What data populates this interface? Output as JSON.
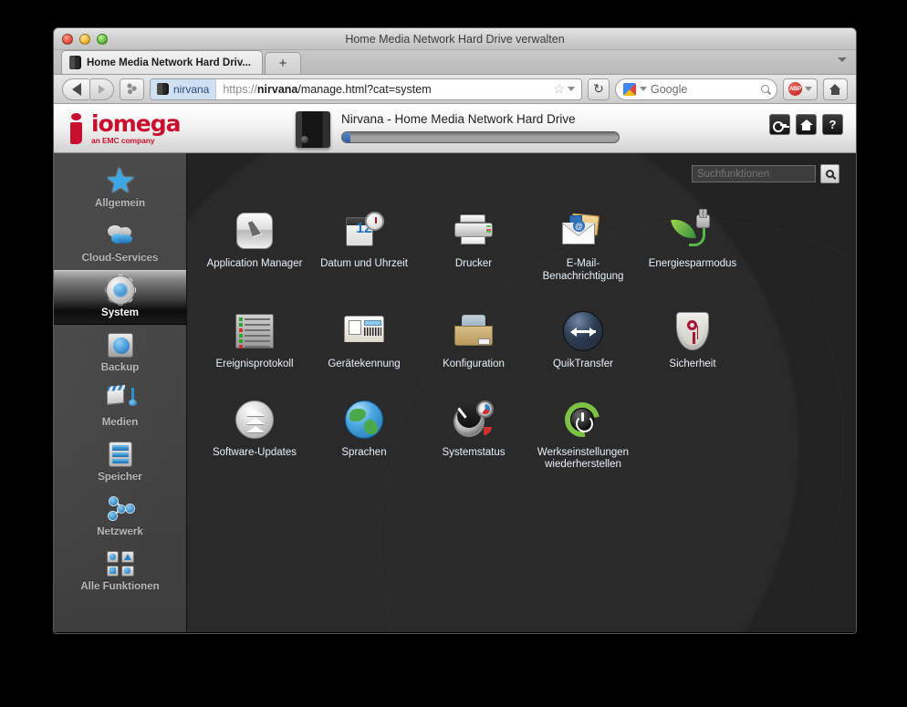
{
  "window": {
    "title": "Home Media Network Hard Drive verwalten",
    "traffic_lights": [
      "close-button",
      "minimize-button",
      "zoom-button"
    ]
  },
  "browser": {
    "tab": {
      "label": "Home Media Network Hard Driv...",
      "favicon": "drive-icon"
    },
    "new_tab_label": "+",
    "toolbar": {
      "back_label": "",
      "forward_label": "",
      "share_label": "",
      "identity_label": "nirvana",
      "url_scheme": "https://",
      "url_host": "nirvana",
      "url_path": "/manage.html?cat=system",
      "url_full": "https://nirvana/manage.html?cat=system",
      "bookmark_star": "☆",
      "reload_label": "↻",
      "search_engine": "Google",
      "adblock_label": "ABP",
      "home_label": ""
    }
  },
  "app": {
    "brand": {
      "name": "iomega",
      "tagline": "an EMC company"
    },
    "device_name": "Nirvana - Home Media Network Hard Drive",
    "capacity_percent": 3,
    "header_buttons": [
      {
        "name": "login-button",
        "icon": "key-icon",
        "label": ""
      },
      {
        "name": "home-button",
        "icon": "home-icon",
        "label": ""
      },
      {
        "name": "help-button",
        "icon": "question-icon",
        "label": "?"
      }
    ],
    "search": {
      "placeholder": "Suchfunktionen",
      "value": "",
      "button_icon": "search-icon"
    },
    "sidebar": {
      "items": [
        {
          "label": "Allgemein",
          "icon": "star-icon",
          "active": false
        },
        {
          "label": "Cloud-Services",
          "icon": "cloud-icon",
          "active": false
        },
        {
          "label": "System",
          "icon": "gear-icon",
          "active": true
        },
        {
          "label": "Backup",
          "icon": "safe-clock-icon",
          "active": false
        },
        {
          "label": "Medien",
          "icon": "media-icon",
          "active": false
        },
        {
          "label": "Speicher",
          "icon": "storage-icon",
          "active": false
        },
        {
          "label": "Netzwerk",
          "icon": "network-icon",
          "active": false
        },
        {
          "label": "Alle Funktionen",
          "icon": "all-functions-icon",
          "active": false
        }
      ]
    },
    "grid": {
      "items": [
        {
          "label": "Application Manager",
          "icon": "cursor-icon"
        },
        {
          "label": "Datum und Uhrzeit",
          "icon": "calendar-clock-icon",
          "calendar_number": "12"
        },
        {
          "label": "Drucker",
          "icon": "printer-icon"
        },
        {
          "label": "E-Mail-Benachrichtigung",
          "icon": "mail-icon",
          "at_symbol": "@"
        },
        {
          "label": "Energiesparmodus",
          "icon": "leaf-plug-icon"
        },
        {
          "label": "Ereignisprotokoll",
          "icon": "log-icon"
        },
        {
          "label": "Gerätekennung",
          "icon": "device-id-icon"
        },
        {
          "label": "Konfiguration",
          "icon": "box-icon"
        },
        {
          "label": "QuikTransfer",
          "icon": "transfer-arrows-icon"
        },
        {
          "label": "Sicherheit",
          "icon": "shield-key-icon"
        },
        {
          "label": "Software-Updates",
          "icon": "upgrade-arrows-icon"
        },
        {
          "label": "Sprachen",
          "icon": "globe-icon"
        },
        {
          "label": "Systemstatus",
          "icon": "gauge-icon"
        },
        {
          "label": "Werkseinstellungen wiederherstellen",
          "icon": "power-reset-icon"
        }
      ]
    }
  },
  "colors": {
    "brand_red": "#c8102e",
    "content_bg": "#222222",
    "sidebar_bg": "#424242",
    "label_text": "#e9f2fa",
    "accent_blue": "#1d6fae"
  }
}
